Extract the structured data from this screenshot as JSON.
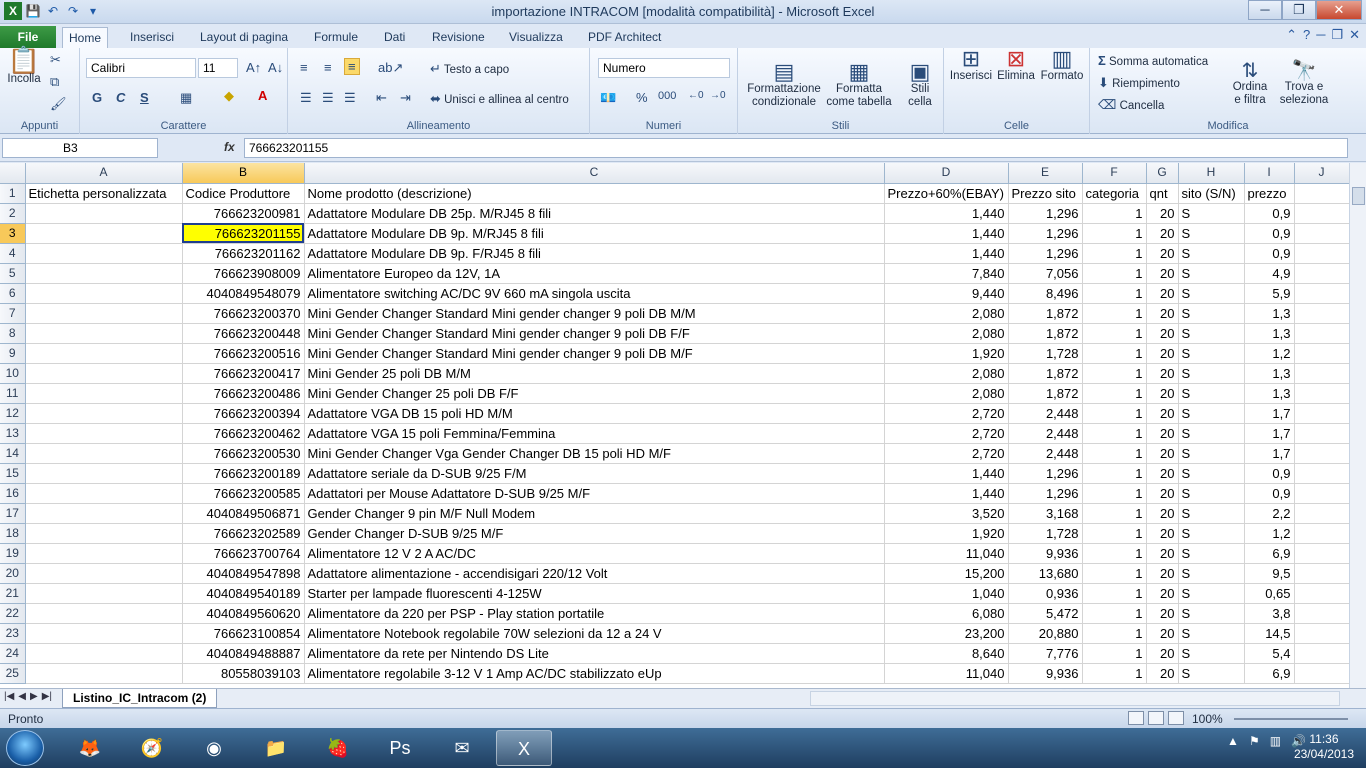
{
  "window": {
    "title": "importazione INTRACOM  [modalità compatibilità]  -  Microsoft Excel",
    "minimize": "─",
    "restore": "❐",
    "close": "✕"
  },
  "qat": {
    "save": "💾",
    "undo": "↶",
    "redo": "↷",
    "customize": "▾"
  },
  "tabs": {
    "file": "File",
    "items": [
      "Home",
      "Inserisci",
      "Layout di pagina",
      "Formule",
      "Dati",
      "Revisione",
      "Visualizza",
      "PDF Architect"
    ],
    "active": "Home"
  },
  "ribbon": {
    "appunti": {
      "label": "Appunti",
      "paste": "Incolla"
    },
    "carattere": {
      "label": "Carattere",
      "font": "Calibri",
      "size": "11",
      "bold": "G",
      "italic": "C",
      "underline": "S"
    },
    "allineamento": {
      "label": "Allineamento",
      "wrap": "Testo a capo",
      "merge": "Unisci e allinea al centro"
    },
    "numeri": {
      "label": "Numeri",
      "format": "Numero",
      "percent": "%",
      "thousands": "000"
    },
    "stili": {
      "label": "Stili",
      "conditional": "Formattazione\ncondizionale",
      "table": "Formatta\ncome tabella",
      "cell": "Stili\ncella"
    },
    "celle": {
      "label": "Celle",
      "insert": "Inserisci",
      "delete": "Elimina",
      "format": "Formato"
    },
    "modifica": {
      "label": "Modifica",
      "autosum": "Somma automatica",
      "fill": "Riempimento",
      "clear": "Cancella",
      "sort": "Ordina\ne filtra",
      "find": "Trova e\nseleziona"
    }
  },
  "formula_bar": {
    "name_box": "B3",
    "fx": "fx",
    "value": "766623201155"
  },
  "columns": [
    "A",
    "B",
    "C",
    "D",
    "E",
    "F",
    "G",
    "H",
    "I",
    "J"
  ],
  "selected_column": "B",
  "selected_row": "3",
  "rows": [
    {
      "n": "1",
      "a": "Etichetta personalizzata",
      "b": "Codice Produttore",
      "c": "Nome prodotto (descrizione)",
      "d": "Prezzo+60%(EBAY)",
      "e": "Prezzo sito",
      "f": "categoria",
      "g": "qnt",
      "h": "sito (S/N)",
      "i": "prezzo"
    },
    {
      "n": "2",
      "a": "",
      "b": "766623200981",
      "c": "Adattatore Modulare DB 25p. M/RJ45 8 fili",
      "d": "1,440",
      "e": "1,296",
      "f": "1",
      "g": "20",
      "h": "S",
      "i": "0,9"
    },
    {
      "n": "3",
      "a": "",
      "b": "766623201155",
      "c": "Adattatore Modulare DB 9p. M/RJ45 8 fili",
      "d": "1,440",
      "e": "1,296",
      "f": "1",
      "g": "20",
      "h": "S",
      "i": "0,9"
    },
    {
      "n": "4",
      "a": "",
      "b": "766623201162",
      "c": "Adattatore Modulare DB 9p. F/RJ45 8 fili",
      "d": "1,440",
      "e": "1,296",
      "f": "1",
      "g": "20",
      "h": "S",
      "i": "0,9"
    },
    {
      "n": "5",
      "a": "",
      "b": "766623908009",
      "c": "Alimentatore Europeo da 12V, 1A",
      "d": "7,840",
      "e": "7,056",
      "f": "1",
      "g": "20",
      "h": "S",
      "i": "4,9"
    },
    {
      "n": "6",
      "a": "",
      "b": "4040849548079",
      "c": "Alimentatore switching AC/DC 9V 660 mA singola uscita",
      "d": "9,440",
      "e": "8,496",
      "f": "1",
      "g": "20",
      "h": "S",
      "i": "5,9"
    },
    {
      "n": "7",
      "a": "",
      "b": "766623200370",
      "c": "Mini Gender Changer Standard Mini gender changer 9 poli DB M/M",
      "d": "2,080",
      "e": "1,872",
      "f": "1",
      "g": "20",
      "h": "S",
      "i": "1,3"
    },
    {
      "n": "8",
      "a": "",
      "b": "766623200448",
      "c": "Mini Gender Changer Standard Mini gender changer 9 poli DB F/F",
      "d": "2,080",
      "e": "1,872",
      "f": "1",
      "g": "20",
      "h": "S",
      "i": "1,3"
    },
    {
      "n": "9",
      "a": "",
      "b": "766623200516",
      "c": "Mini Gender Changer Standard Mini gender changer 9 poli DB M/F",
      "d": "1,920",
      "e": "1,728",
      "f": "1",
      "g": "20",
      "h": "S",
      "i": "1,2"
    },
    {
      "n": "10",
      "a": "",
      "b": "766623200417",
      "c": "Mini Gender 25 poli DB M/M",
      "d": "2,080",
      "e": "1,872",
      "f": "1",
      "g": "20",
      "h": "S",
      "i": "1,3"
    },
    {
      "n": "11",
      "a": "",
      "b": "766623200486",
      "c": "Mini Gender Changer 25 poli DB F/F",
      "d": "2,080",
      "e": "1,872",
      "f": "1",
      "g": "20",
      "h": "S",
      "i": "1,3"
    },
    {
      "n": "12",
      "a": "",
      "b": "766623200394",
      "c": "Adattatore VGA DB 15 poli HD M/M",
      "d": "2,720",
      "e": "2,448",
      "f": "1",
      "g": "20",
      "h": "S",
      "i": "1,7"
    },
    {
      "n": "13",
      "a": "",
      "b": "766623200462",
      "c": "Adattatore VGA 15 poli Femmina/Femmina",
      "d": "2,720",
      "e": "2,448",
      "f": "1",
      "g": "20",
      "h": "S",
      "i": "1,7"
    },
    {
      "n": "14",
      "a": "",
      "b": "766623200530",
      "c": "Mini Gender Changer Vga Gender Changer DB 15 poli HD M/F",
      "d": "2,720",
      "e": "2,448",
      "f": "1",
      "g": "20",
      "h": "S",
      "i": "1,7"
    },
    {
      "n": "15",
      "a": "",
      "b": "766623200189",
      "c": "Adattatore seriale da D-SUB 9/25 F/M",
      "d": "1,440",
      "e": "1,296",
      "f": "1",
      "g": "20",
      "h": "S",
      "i": "0,9"
    },
    {
      "n": "16",
      "a": "",
      "b": "766623200585",
      "c": "Adattatori per Mouse Adattatore D-SUB 9/25 M/F",
      "d": "1,440",
      "e": "1,296",
      "f": "1",
      "g": "20",
      "h": "S",
      "i": "0,9"
    },
    {
      "n": "17",
      "a": "",
      "b": "4040849506871",
      "c": "Gender Changer 9 pin M/F Null Modem",
      "d": "3,520",
      "e": "3,168",
      "f": "1",
      "g": "20",
      "h": "S",
      "i": "2,2"
    },
    {
      "n": "18",
      "a": "",
      "b": "766623202589",
      "c": "Gender Changer D-SUB 9/25 M/F",
      "d": "1,920",
      "e": "1,728",
      "f": "1",
      "g": "20",
      "h": "S",
      "i": "1,2"
    },
    {
      "n": "19",
      "a": "",
      "b": "766623700764",
      "c": "Alimentatore 12 V 2 A AC/DC",
      "d": "11,040",
      "e": "9,936",
      "f": "1",
      "g": "20",
      "h": "S",
      "i": "6,9"
    },
    {
      "n": "20",
      "a": "",
      "b": "4040849547898",
      "c": "Adattatore alimentazione - accendisigari 220/12 Volt",
      "d": "15,200",
      "e": "13,680",
      "f": "1",
      "g": "20",
      "h": "S",
      "i": "9,5"
    },
    {
      "n": "21",
      "a": "",
      "b": "4040849540189",
      "c": "Starter per lampade fluorescenti 4-125W",
      "d": "1,040",
      "e": "0,936",
      "f": "1",
      "g": "20",
      "h": "S",
      "i": "0,65"
    },
    {
      "n": "22",
      "a": "",
      "b": "4040849560620",
      "c": "Alimentatore da 220 per PSP - Play station portatile",
      "d": "6,080",
      "e": "5,472",
      "f": "1",
      "g": "20",
      "h": "S",
      "i": "3,8"
    },
    {
      "n": "23",
      "a": "",
      "b": "766623100854",
      "c": "Alimentatore Notebook regolabile 70W selezioni da 12 a 24 V",
      "d": "23,200",
      "e": "20,880",
      "f": "1",
      "g": "20",
      "h": "S",
      "i": "14,5"
    },
    {
      "n": "24",
      "a": "",
      "b": "4040849488887",
      "c": "Alimentatore da rete per Nintendo DS Lite",
      "d": "8,640",
      "e": "7,776",
      "f": "1",
      "g": "20",
      "h": "S",
      "i": "5,4"
    },
    {
      "n": "25",
      "a": "",
      "b": "80558039103",
      "c": "Alimentatore regolabile  3-12 V 1 Amp AC/DC stabilizzato eUp",
      "d": "11,040",
      "e": "9,936",
      "f": "1",
      "g": "20",
      "h": "S",
      "i": "6,9"
    }
  ],
  "sheet_tab": "Listino_IC_Intracom (2)",
  "status": {
    "ready": "Pronto",
    "zoom": "100%"
  },
  "taskbar": {
    "time": "11:36",
    "date": "23/04/2013"
  }
}
